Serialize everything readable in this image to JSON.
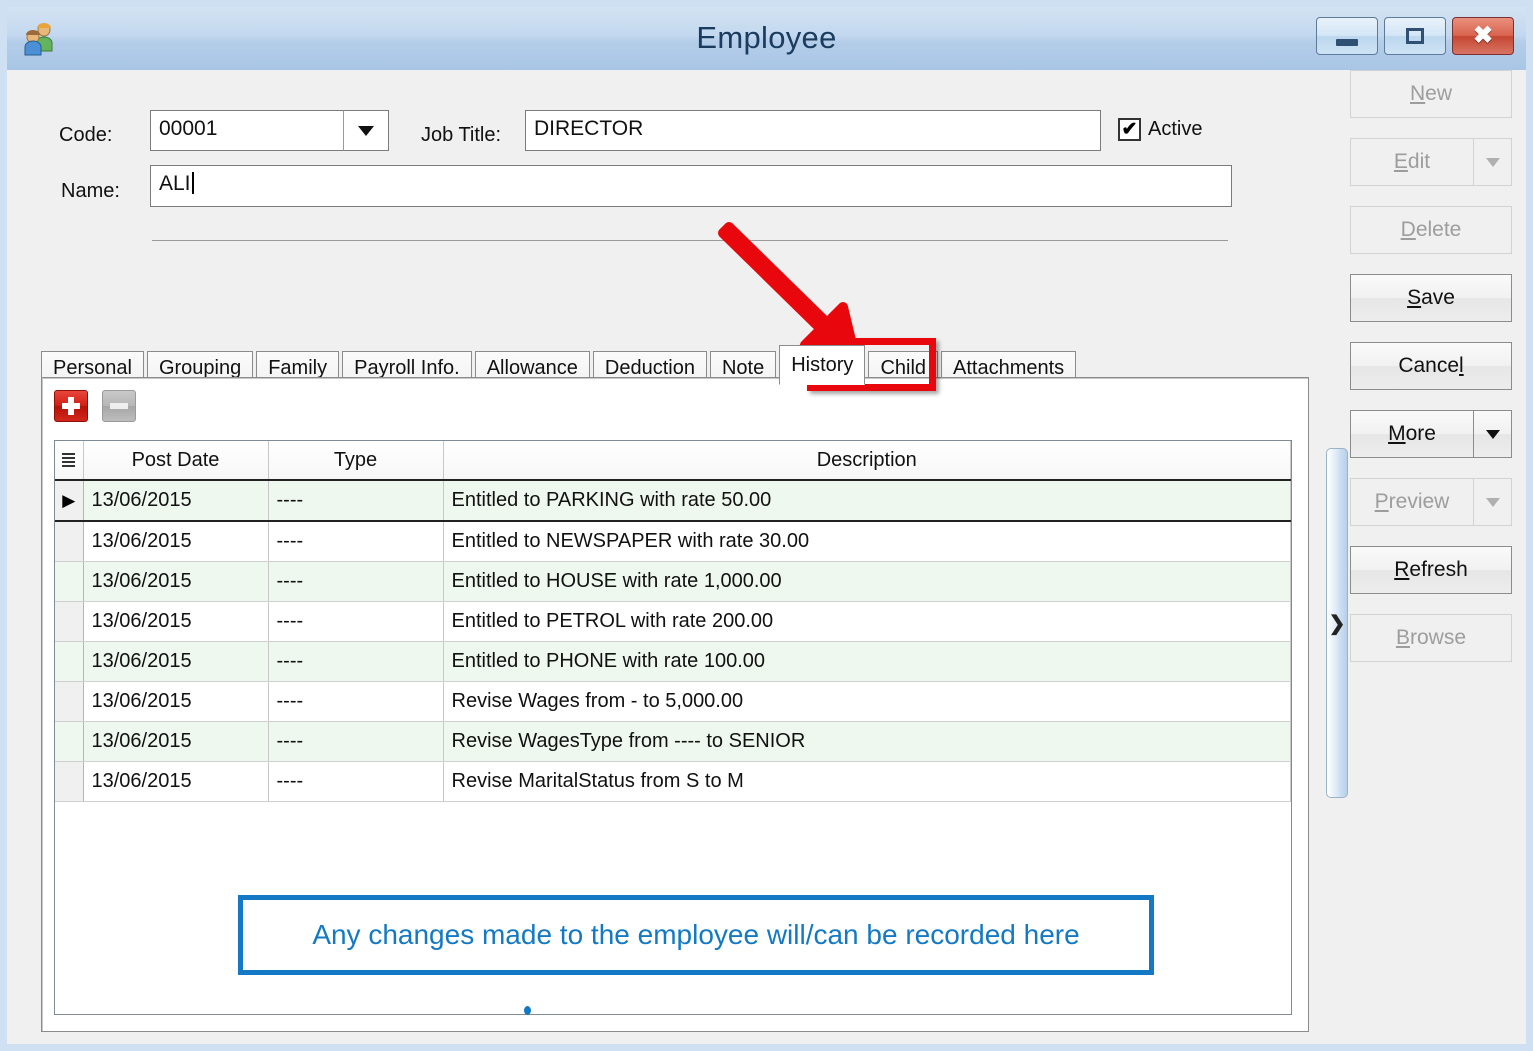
{
  "window": {
    "title": "Employee",
    "icon": "employee-people-icon",
    "controls": {
      "minimize": "minimize-icon",
      "maximize": "maximize-icon",
      "close": "close-icon"
    }
  },
  "form": {
    "code": {
      "label": "Code:",
      "value": "00001"
    },
    "job_title": {
      "label": "Job Title:",
      "value": "DIRECTOR"
    },
    "name": {
      "label": "Name:",
      "value": "ALI"
    },
    "active": {
      "label": "Active",
      "checked": true,
      "check_glyph": "✔"
    }
  },
  "actions": [
    {
      "label": "New",
      "accel": "N",
      "enabled": false,
      "split": false
    },
    {
      "label": "Edit",
      "accel": "E",
      "enabled": false,
      "split": true
    },
    {
      "label": "Delete",
      "accel": "D",
      "enabled": false,
      "split": false
    },
    {
      "label": "Save",
      "accel": "S",
      "enabled": true,
      "split": false
    },
    {
      "label": "Cancel",
      "accel": "l",
      "enabled": true,
      "split": false
    },
    {
      "label": "More",
      "accel": "M",
      "enabled": true,
      "split": true
    },
    {
      "label": "Preview",
      "accel": "P",
      "enabled": false,
      "split": true
    },
    {
      "label": "Refresh",
      "accel": "R",
      "enabled": true,
      "split": false
    },
    {
      "label": "Browse",
      "accel": "B",
      "enabled": false,
      "split": false
    }
  ],
  "tabs": [
    {
      "label": "Personal",
      "active": false
    },
    {
      "label": "Grouping",
      "active": false
    },
    {
      "label": "Family",
      "active": false
    },
    {
      "label": "Payroll Info.",
      "active": false
    },
    {
      "label": "Allowance",
      "active": false
    },
    {
      "label": "Deduction",
      "active": false
    },
    {
      "label": "Note",
      "active": false
    },
    {
      "label": "History",
      "active": true
    },
    {
      "label": "Child",
      "active": false
    },
    {
      "label": "Attachments",
      "active": false
    }
  ],
  "grid_toolbar": {
    "add": {
      "name": "add-row-button",
      "enabled": true
    },
    "remove": {
      "name": "remove-row-button",
      "enabled": false
    }
  },
  "history_grid": {
    "columns": [
      "Post Date",
      "Type",
      "Description"
    ],
    "rows": [
      {
        "post_date": "13/06/2015",
        "type": "----",
        "description": "Entitled to PARKING with rate 50.00",
        "selected": true
      },
      {
        "post_date": "13/06/2015",
        "type": "----",
        "description": "Entitled to NEWSPAPER with rate 30.00",
        "selected": false
      },
      {
        "post_date": "13/06/2015",
        "type": "----",
        "description": "Entitled to HOUSE with rate 1,000.00",
        "selected": false
      },
      {
        "post_date": "13/06/2015",
        "type": "----",
        "description": "Entitled to PETROL with rate 200.00",
        "selected": false
      },
      {
        "post_date": "13/06/2015",
        "type": "----",
        "description": "Entitled to PHONE with rate 100.00",
        "selected": false
      },
      {
        "post_date": "13/06/2015",
        "type": "----",
        "description": "Revise Wages from - to 5,000.00",
        "selected": false
      },
      {
        "post_date": "13/06/2015",
        "type": "----",
        "description": "Revise WagesType from ---- to SENIOR",
        "selected": false
      },
      {
        "post_date": "13/06/2015",
        "type": "----",
        "description": "Revise MaritalStatus from S to M",
        "selected": false
      }
    ]
  },
  "splitter": {
    "glyph": "❯"
  },
  "annotations": {
    "callout_text": "Any changes made to the employee will/can be recorded here",
    "callout_color": "#1479c4",
    "arrow_color": "#e8070d",
    "highlight_color": "#e8070d",
    "highlight_target": "History"
  }
}
